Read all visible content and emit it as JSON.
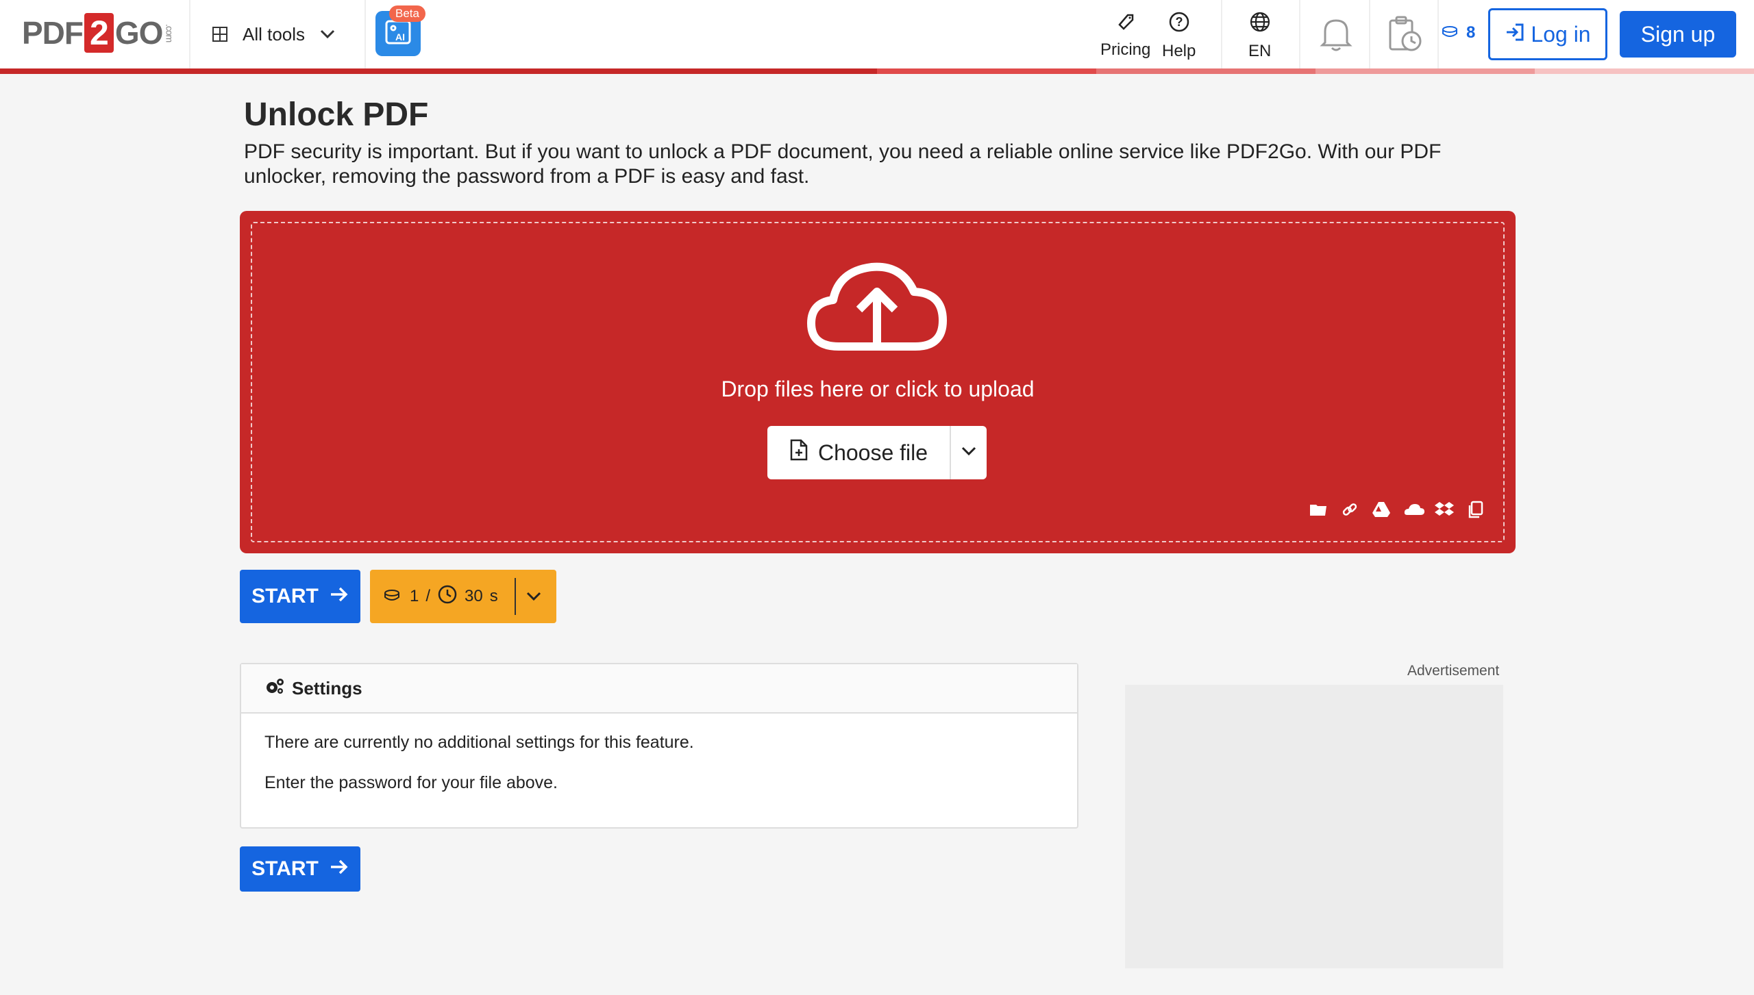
{
  "header": {
    "logo": {
      "left": "PDF",
      "mid": "2",
      "right": "GO",
      "suffix": ".com"
    },
    "all_tools_label": "All tools",
    "ai_badge": "Beta",
    "pricing_label": "Pricing",
    "help_label": "Help",
    "language_label": "EN",
    "credits_count": "8",
    "login_label": "Log in",
    "signup_label": "Sign up"
  },
  "colors": {
    "brand_red": "#c62828",
    "primary_blue": "#1565e0",
    "cost_orange": "#f5a623"
  },
  "main": {
    "title": "Unlock PDF",
    "description": "PDF security is important. But if you want to unlock a PDF document, you need a reliable online service like PDF2Go. With our PDF unlocker, removing the password from a PDF is easy and fast.",
    "upload": {
      "prompt": "Drop files here or click to upload",
      "choose_label": "Choose file",
      "sources": [
        "folder-icon",
        "link-icon",
        "google-drive-icon",
        "onedrive-icon",
        "dropbox-icon",
        "clipboard-icon"
      ]
    },
    "start_label": "START",
    "cost": {
      "credits": "1",
      "divider": "/",
      "time": "30",
      "unit": "s"
    },
    "settings": {
      "title": "Settings",
      "line1": "There are currently no additional settings for this feature.",
      "line2": "Enter the password for your file above."
    },
    "advertisement_label": "Advertisement"
  }
}
